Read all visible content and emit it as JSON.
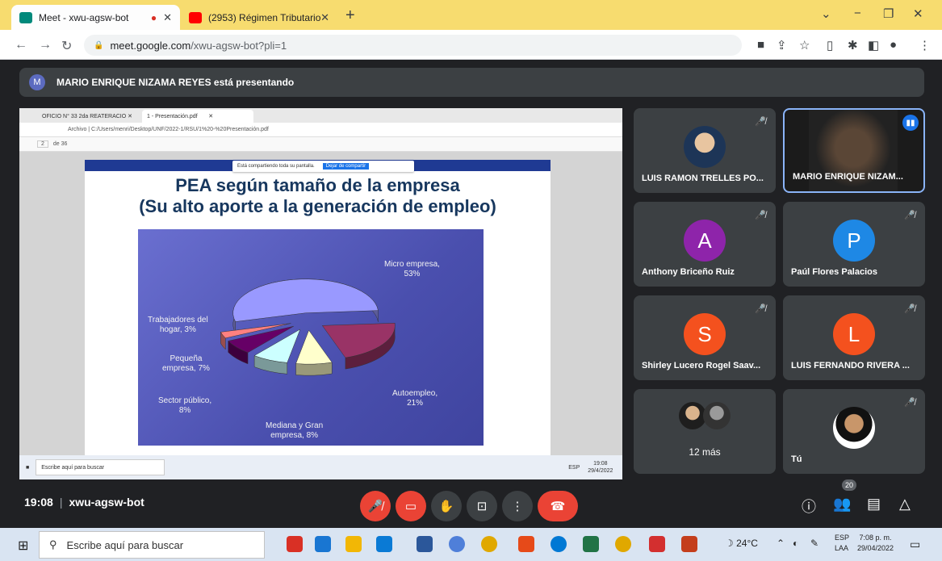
{
  "browser": {
    "tabs": [
      {
        "title": "Meet - xwu-agsw-bot",
        "favicon_color": "#00897b"
      },
      {
        "title": "(2953) Régimen Tributario Sunat",
        "favicon_color": "#ff0000"
      }
    ],
    "url_host": "meet.google.com",
    "url_path": "/xwu-agsw-bot?pli=1"
  },
  "meet": {
    "presenter_initial": "M",
    "presenter_text": "MARIO ENRIQUE NIZAMA REYES está presentando",
    "meeting_time": "19:08",
    "meeting_code": "xwu-agsw-bot",
    "participants_count": "20",
    "participants": [
      {
        "name": "LUIS RAMON TRELLES PO...",
        "type": "photo"
      },
      {
        "name": "MARIO ENRIQUE NIZAM...",
        "type": "video"
      },
      {
        "name": "Anthony Briceño Ruiz",
        "initial": "A",
        "color": "#8e24aa"
      },
      {
        "name": "Paúl Flores Palacios",
        "initial": "P",
        "color": "#1e88e5"
      },
      {
        "name": "Shirley Lucero Rogel Saav...",
        "initial": "S",
        "color": "#f4511e"
      },
      {
        "name": "LUIS FERNANDO RIVERA ...",
        "initial": "L",
        "color": "#f4511e"
      },
      {
        "name": "12 más",
        "type": "group"
      },
      {
        "name": "Tú",
        "type": "photo"
      }
    ]
  },
  "shared_screen": {
    "inner_tabs": [
      "OFICIO N° 33 2da REATERACIO",
      "1 - Presentación.pdf"
    ],
    "inner_url": "Archivo  |  C:/Users/menri/Desktop/UNF/2022-1/RSU/1%20-%20Presentación.pdf",
    "page_current": "2",
    "page_total": "de 36",
    "share_notice": "Está compartiendo toda su pantalla.",
    "stop_share": "Dejar de compartir",
    "slide_title_1": "PEA según tamaño de la empresa",
    "slide_title_2": "(Su alto aporte a la generación de empleo)",
    "inner_search": "Escribe aquí para buscar",
    "inner_time": "19:08",
    "inner_date": "29/4/2022",
    "inner_lang": "ESP"
  },
  "chart_data": {
    "type": "pie",
    "categories": [
      "Micro empresa",
      "Autoempleo",
      "Mediana y Gran empresa",
      "Sector público",
      "Pequeña empresa",
      "Trabajadores del hogar"
    ],
    "values": [
      53,
      21,
      8,
      8,
      7,
      3
    ],
    "labels": [
      "Micro empresa,\n53%",
      "Autoempleo,\n21%",
      "Mediana y Gran\nempresa, 8%",
      "Sector público,\n8%",
      "Pequeña\nempresa, 7%",
      "Trabajadores del\nhogar, 3%"
    ],
    "colors": [
      "#9999ff",
      "#993366",
      "#ffffcc",
      "#ccffff",
      "#660066",
      "#ff8080"
    ]
  },
  "taskbar": {
    "search_placeholder": "Escribe aquí para buscar",
    "temperature": "24°C",
    "lang_1": "ESP",
    "lang_2": "LAA",
    "time": "7:08 p. m.",
    "date": "29/04/2022"
  }
}
